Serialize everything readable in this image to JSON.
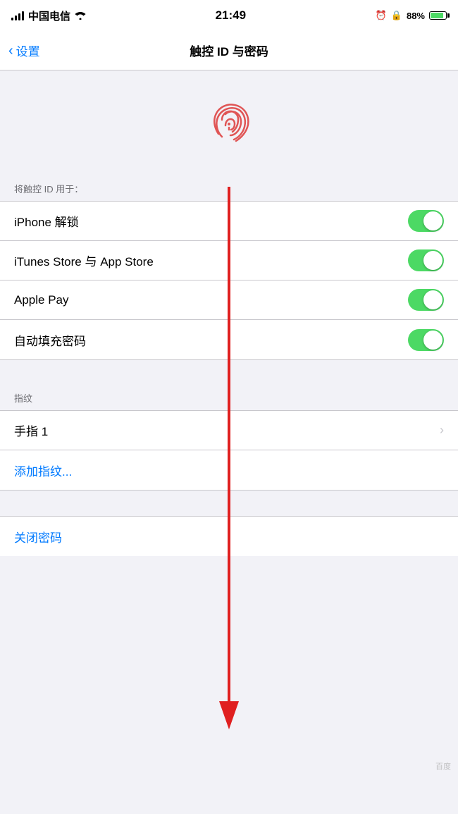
{
  "statusBar": {
    "carrier": "中国电信",
    "time": "21:49",
    "batteryPercent": "88%",
    "wifiIcon": "wifi",
    "signalIcon": "signal"
  },
  "navBar": {
    "backLabel": "设置",
    "title": "触控 ID 与密码"
  },
  "sectionLabel": "将触控 ID 用于：",
  "toggleRows": [
    {
      "label": "iPhone 解锁",
      "enabled": true
    },
    {
      "label": "iTunes Store 与 App Store",
      "enabled": true
    },
    {
      "label": "Apple Pay",
      "enabled": true
    },
    {
      "label": "自动填充密码",
      "enabled": true
    }
  ],
  "fingerprintSection": {
    "sectionLabel": "指纹",
    "finger1Label": "手指 1",
    "addFingerprintLabel": "添加指纹..."
  },
  "closePasscodeLabel": "关闭密码",
  "watermark": "Baidu"
}
